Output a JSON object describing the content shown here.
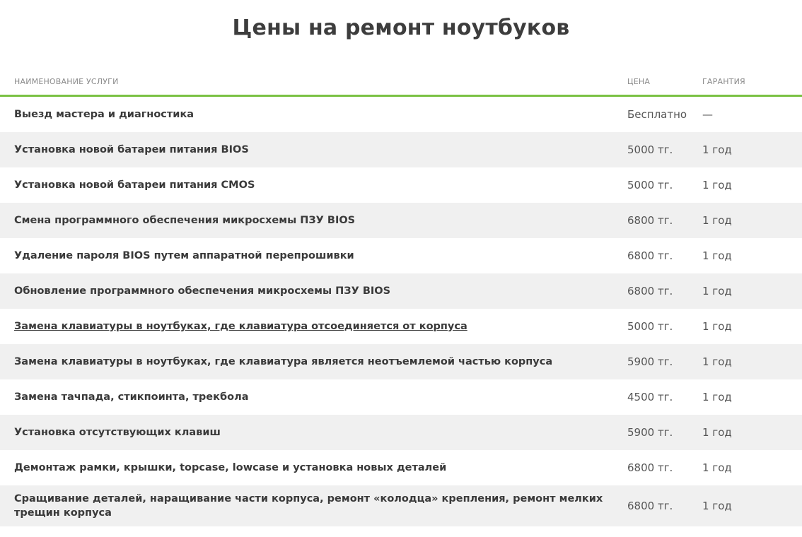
{
  "page": {
    "title": "Цены на ремонт ноутбуков"
  },
  "table": {
    "headers": {
      "name": "Наименование услуги",
      "price": "Цена",
      "warranty": "Гарантия"
    },
    "rows": [
      {
        "name": "Выезд мастера и диагностика",
        "price": "Бесплатно",
        "warranty": "—",
        "link": false
      },
      {
        "name": "Установка новой батареи питания BIOS",
        "price": "5000 тг.",
        "warranty": "1 год",
        "link": false
      },
      {
        "name": "Установка новой батареи питания CMOS",
        "price": "5000 тг.",
        "warranty": "1 год",
        "link": false
      },
      {
        "name": "Смена программного обеспечения микросхемы ПЗУ BIOS",
        "price": "6800 тг.",
        "warranty": "1 год",
        "link": false
      },
      {
        "name": "Удаление пароля BIOS путем аппаратной перепрошивки",
        "price": "6800 тг.",
        "warranty": "1 год",
        "link": false
      },
      {
        "name": "Обновление программного обеспечения микросхемы ПЗУ BIOS",
        "price": "6800 тг.",
        "warranty": "1 год",
        "link": false
      },
      {
        "name": "Замена клавиатуры в ноутбуках, где клавиатура отсоединяется от корпуса",
        "price": "5000 тг.",
        "warranty": "1 год",
        "link": true
      },
      {
        "name": "Замена клавиатуры в ноутбуках, где клавиатура является неотъемлемой частью корпуса",
        "price": "5900 тг.",
        "warranty": "1 год",
        "link": false
      },
      {
        "name": "Замена тачпада, стикпоинта, трекбола",
        "price": "4500 тг.",
        "warranty": "1 год",
        "link": false
      },
      {
        "name": "Установка отсутствующих клавиш",
        "price": "5900 тг.",
        "warranty": "1 год",
        "link": false
      },
      {
        "name": "Демонтаж рамки, крышки, topcase, lowcase и установка новых деталей",
        "price": "6800 тг.",
        "warranty": "1 год",
        "link": false
      },
      {
        "name": "Сращивание деталей, наращивание части корпуса, ремонт «колодца» крепления, ремонт мелких трещин корпуса",
        "price": "6800 тг.",
        "warranty": "1 год",
        "link": false
      }
    ]
  },
  "colors": {
    "accent": "#7ac143",
    "row_alt": "#f0f0f0",
    "text": "#3a3a3a"
  }
}
